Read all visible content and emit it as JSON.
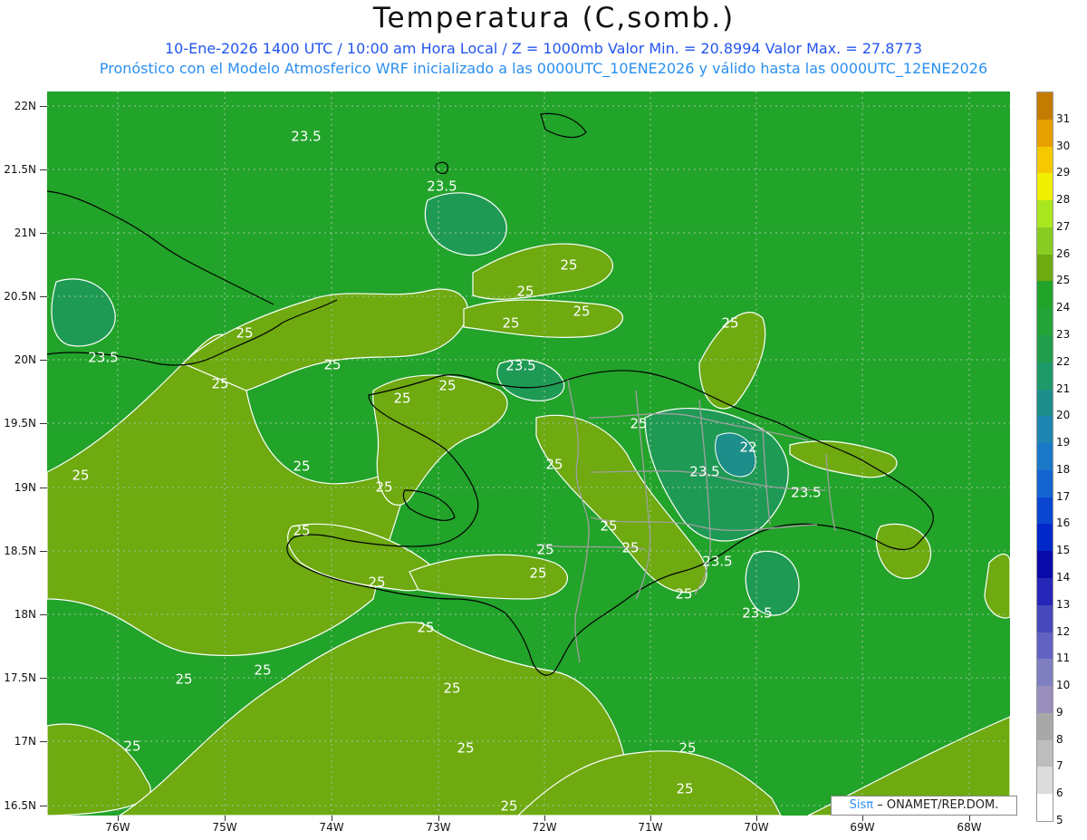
{
  "header": {
    "title": "Temperatura (C,somb.)",
    "subtitle_line1": "10-Ene-2026 1400 UTC / 10:00 am Hora Local / Z = 1000mb   Valor Min. = 20.8994  Valor Max. = 27.8773",
    "subtitle_line2": "Pronóstico con el Modelo Atmosferico WRF inicializado a las 0000UTC_10ENE2026 y válido hasta las  0000UTC_12ENE2026"
  },
  "axes": {
    "latitude_labels": [
      "22N",
      "21.5N",
      "21N",
      "20.5N",
      "20N",
      "19.5N",
      "19N",
      "18.5N",
      "18N",
      "17.5N",
      "17N",
      "16.5N"
    ],
    "longitude_labels": [
      "76W",
      "75W",
      "74W",
      "73W",
      "72W",
      "71W",
      "70W",
      "69W",
      "68W"
    ]
  },
  "contour_labels": {
    "c25": "25",
    "c235": "23.5",
    "c22": "22"
  },
  "legend": {
    "levels": [
      "5",
      "6",
      "7",
      "8",
      "9",
      "10",
      "11",
      "12",
      "13",
      "14",
      "15",
      "16",
      "17",
      "18",
      "19",
      "20",
      "21",
      "22",
      "23",
      "24",
      "25",
      "26",
      "27",
      "28",
      "29",
      "30",
      "31"
    ],
    "colors": [
      "#ffffff",
      "#dcdcdc",
      "#bdbdbd",
      "#a8a8a8",
      "#9a8fbc",
      "#7f7fc0",
      "#6262c2",
      "#4848bd",
      "#2626b8",
      "#0a0aa8",
      "#0028c8",
      "#0a46d0",
      "#1464d2",
      "#1a78c8",
      "#1e86b0",
      "#1e8e8a",
      "#1e9a6a",
      "#229e4c",
      "#24a338",
      "#22a32a",
      "#6eaa10",
      "#88cc22",
      "#aae61e",
      "#f0f000",
      "#f6c800",
      "#e6a000",
      "#c47c00"
    ]
  },
  "credit": {
    "logo": "Sisπ",
    "text": "– ONAMET/REP.DOM."
  },
  "colors": {
    "field_base": "#22a32a",
    "field_warm": "#6eaa10",
    "field_cool": "#1f9a55",
    "contour": "#ffffff",
    "coast": "#000000",
    "border": "#a0a0a0"
  }
}
